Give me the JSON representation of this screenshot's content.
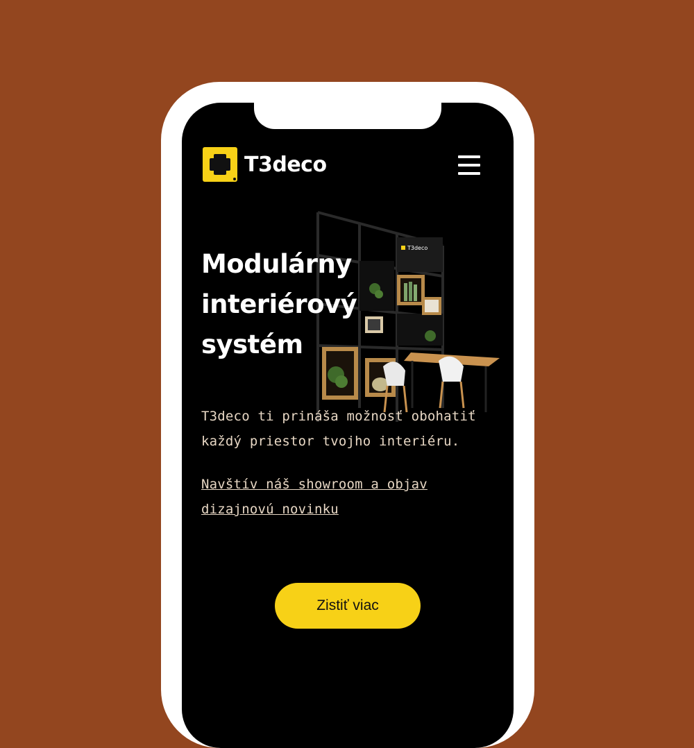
{
  "brand": {
    "name": "T3deco",
    "accent": "#f7d117"
  },
  "header": {
    "menu_icon": "hamburger-menu-icon"
  },
  "hero": {
    "headline": "Modulárny interiérový systém",
    "description": "T3deco ti prináša možnosť obohatiť každý priestor tvojho interiéru.",
    "showroom_link": "Navštív náš showroom a objav dizajnovú novinku",
    "cta_label": "Zistiť viac"
  },
  "illustration": {
    "panel_brand": "T3deco"
  },
  "colors": {
    "background": "#93461f",
    "screen": "#000000",
    "text_muted": "#e7d7c4"
  }
}
